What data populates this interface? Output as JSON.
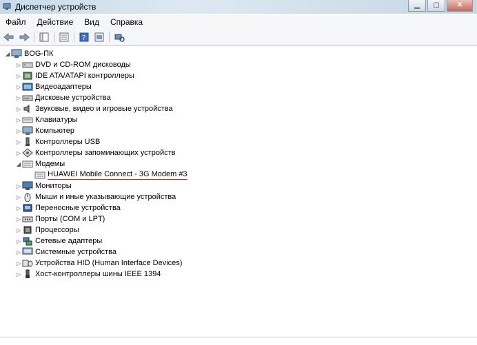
{
  "window": {
    "title": "Диспетчер устройств"
  },
  "menu": [
    "Файл",
    "Действие",
    "Вид",
    "Справка"
  ],
  "toolbar": [
    "back-icon",
    "forward-icon",
    "sep",
    "properties-icon",
    "sep",
    "console-tree-icon",
    "sep",
    "help-icon",
    "update-icon",
    "sep",
    "scan-hardware-icon"
  ],
  "tree": {
    "root": "BOG-ПК",
    "items": [
      {
        "label": "DVD и CD-ROM дисководы",
        "icon": "dvd-drive-icon",
        "expanded": false
      },
      {
        "label": "IDE ATA/ATAPI контроллеры",
        "icon": "ide-controller-icon",
        "expanded": false
      },
      {
        "label": "Видеоадаптеры",
        "icon": "display-adapter-icon",
        "expanded": false
      },
      {
        "label": "Дисковые устройства",
        "icon": "disk-drive-icon",
        "expanded": false
      },
      {
        "label": "Звуковые, видео и игровые устройства",
        "icon": "speaker-icon",
        "expanded": false
      },
      {
        "label": "Клавиатуры",
        "icon": "keyboard-icon",
        "expanded": false
      },
      {
        "label": "Компьютер",
        "icon": "computer-icon",
        "expanded": false
      },
      {
        "label": "Контроллеры USB",
        "icon": "usb-icon",
        "expanded": false
      },
      {
        "label": "Контроллеры запоминающих устройств",
        "icon": "storage-controller-icon",
        "expanded": false
      },
      {
        "label": "Модемы",
        "icon": "modem-icon",
        "expanded": true,
        "children": [
          {
            "label": "HUAWEI Mobile Connect - 3G Modem #3",
            "icon": "modem-icon"
          }
        ]
      },
      {
        "label": "Мониторы",
        "icon": "monitor-icon",
        "expanded": false
      },
      {
        "label": "Мыши и иные указывающие устройства",
        "icon": "mouse-icon",
        "expanded": false
      },
      {
        "label": "Переносные устройства",
        "icon": "portable-device-icon",
        "expanded": false
      },
      {
        "label": "Порты (COM и LPT)",
        "icon": "port-icon",
        "expanded": false
      },
      {
        "label": "Процессоры",
        "icon": "processor-icon",
        "expanded": false
      },
      {
        "label": "Сетевые адаптеры",
        "icon": "network-adapter-icon",
        "expanded": false
      },
      {
        "label": "Системные устройства",
        "icon": "system-device-icon",
        "expanded": false
      },
      {
        "label": "Устройства HID (Human Interface Devices)",
        "icon": "hid-icon",
        "expanded": false
      },
      {
        "label": "Хост-контроллеры шины IEEE 1394",
        "icon": "ieee1394-icon",
        "expanded": false
      }
    ]
  },
  "colors": {
    "highlight_underline": "#c0302b"
  }
}
